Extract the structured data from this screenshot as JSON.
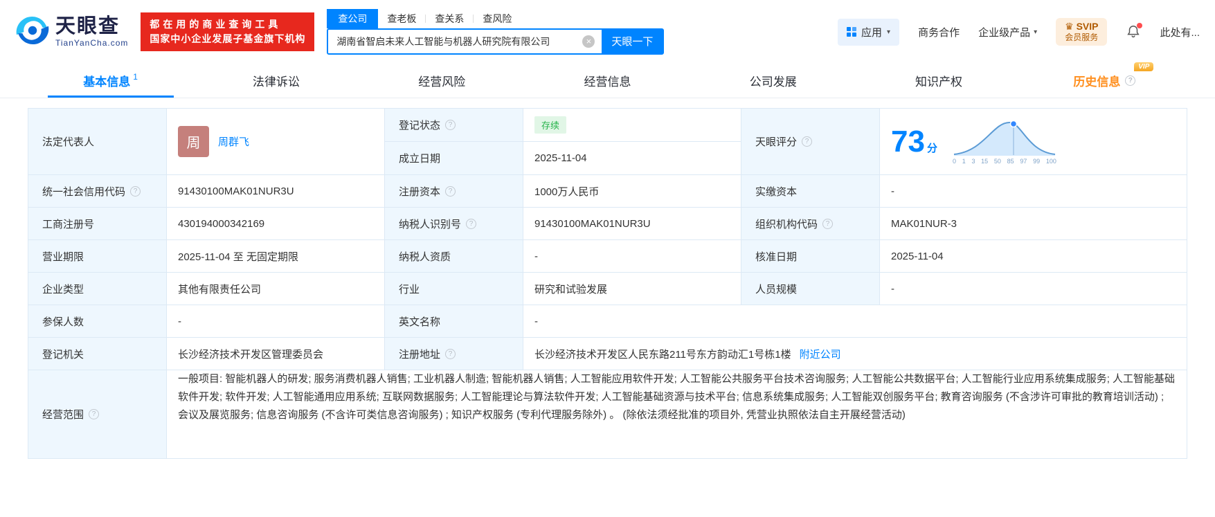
{
  "colors": {
    "brand": "#0084ff",
    "banner_red": "#e7281e",
    "status_green": "#26b34a",
    "vip_orange": "#ff8f1f",
    "label_bg": "#eef7fe"
  },
  "icons": {
    "info": "?",
    "clear": "×",
    "caret": "▾",
    "crown": "♛"
  },
  "header": {
    "logo": {
      "title": "天眼查",
      "subtitle": "TianYanCha.com"
    },
    "banner": {
      "line1": "都在用的商业查询工具",
      "line2": "国家中小企业发展子基金旗下机构"
    },
    "search": {
      "tabs": [
        {
          "label": "查公司"
        },
        {
          "label": "查老板"
        },
        {
          "label": "查关系"
        },
        {
          "label": "查风险"
        }
      ],
      "value": "湖南省智启未来人工智能与机器人研究院有限公司",
      "button": "天眼一下"
    },
    "right": {
      "apps": "应用",
      "cooperation": "商务合作",
      "enterprise": "企业级产品",
      "svip_line1": "SVIP",
      "svip_line2": "会员服务",
      "more": "此处有..."
    }
  },
  "nav": {
    "tabs": [
      {
        "label": "基本信息",
        "badge": "1"
      },
      {
        "label": "法律诉讼"
      },
      {
        "label": "经营风险"
      },
      {
        "label": "经营信息"
      },
      {
        "label": "公司发展"
      },
      {
        "label": "知识产权"
      },
      {
        "label": "历史信息",
        "vip_label": "VIP"
      }
    ]
  },
  "table": {
    "legal_rep": {
      "label": "法定代表人",
      "avatar_char": "周",
      "name": "周群飞"
    },
    "reg_status": {
      "label": "登记状态",
      "value": "存续"
    },
    "establish_date": {
      "label": "成立日期",
      "value": "2025-11-04"
    },
    "score": {
      "label": "天眼评分",
      "value": "73",
      "unit": "分",
      "axis": [
        "0",
        "1",
        "3",
        "15",
        "50",
        "85",
        "97",
        "99",
        "100"
      ]
    },
    "credit_code": {
      "label": "统一社会信用代码",
      "value": "91430100MAK01NUR3U"
    },
    "reg_capital": {
      "label": "注册资本",
      "value": "1000万人民币"
    },
    "paid_capital": {
      "label": "实缴资本",
      "value": "-"
    },
    "reg_number": {
      "label": "工商注册号",
      "value": "430194000342169"
    },
    "taxpayer_id": {
      "label": "纳税人识别号",
      "value": "91430100MAK01NUR3U"
    },
    "org_code": {
      "label": "组织机构代码",
      "value": "MAK01NUR-3"
    },
    "business_term": {
      "label": "营业期限",
      "value": "2025-11-04 至 无固定期限"
    },
    "taxpayer_qualification": {
      "label": "纳税人资质",
      "value": "-"
    },
    "approval_date": {
      "label": "核准日期",
      "value": "2025-11-04"
    },
    "company_type": {
      "label": "企业类型",
      "value": "其他有限责任公司"
    },
    "industry": {
      "label": "行业",
      "value": "研究和试验发展"
    },
    "staff_size": {
      "label": "人员规模",
      "value": "-"
    },
    "insured_count": {
      "label": "参保人数",
      "value": "-"
    },
    "english_name": {
      "label": "英文名称",
      "value": "-"
    },
    "reg_authority": {
      "label": "登记机关",
      "value": "长沙经济技术开发区管理委员会"
    },
    "reg_address": {
      "label": "注册地址",
      "value": "长沙经济技术开发区人民东路211号东方韵动汇1号栋1楼",
      "link": "附近公司"
    },
    "business_scope": {
      "label": "经营范围",
      "value": "一般项目: 智能机器人的研发; 服务消费机器人销售; 工业机器人制造; 智能机器人销售; 人工智能应用软件开发; 人工智能公共服务平台技术咨询服务; 人工智能公共数据平台; 人工智能行业应用系统集成服务; 人工智能基础软件开发; 软件开发; 人工智能通用应用系统; 互联网数据服务; 人工智能理论与算法软件开发; 人工智能基础资源与技术平台; 信息系统集成服务; 人工智能双创服务平台; 教育咨询服务 (不含涉许可审批的教育培训活动) ; 会议及展览服务; 信息咨询服务 (不含许可类信息咨询服务) ; 知识产权服务 (专利代理服务除外) 。 (除依法须经批准的项目外, 凭营业执照依法自主开展经营活动)"
    }
  }
}
